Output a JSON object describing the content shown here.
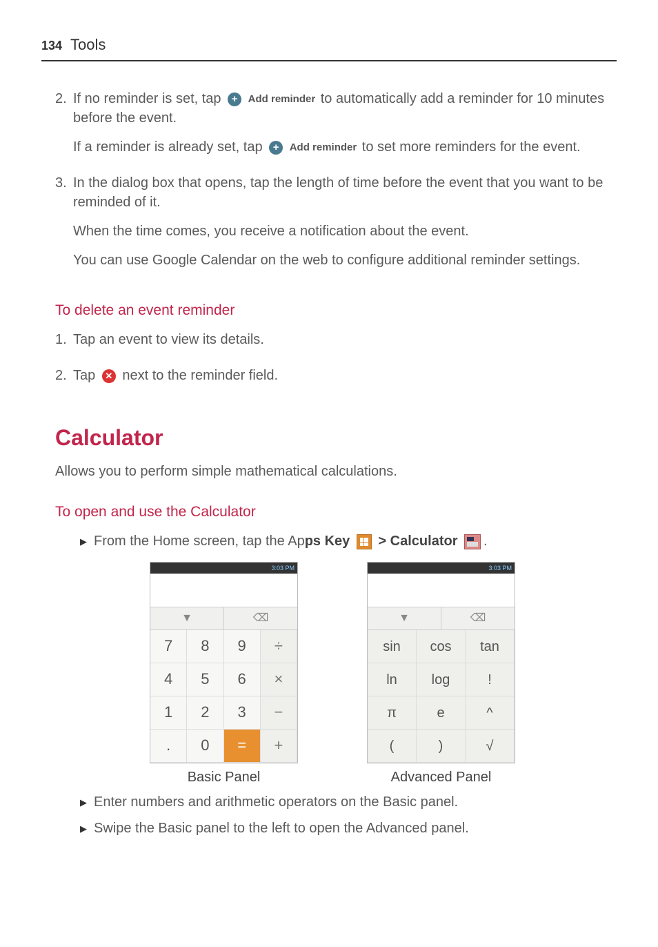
{
  "header": {
    "page": "134",
    "title": "Tools"
  },
  "steps": {
    "s2_num": "2.",
    "s2_a": "If no reminder is set, tap ",
    "s2_b": " to automatically add a reminder for 10 minutes before the event.",
    "s2_c": "If a reminder is already set, tap ",
    "s2_d": " to set more reminders for the event.",
    "add_reminder_label": "Add reminder",
    "s3_num": "3.",
    "s3_a": "In the dialog box that opens, tap the length of time before the event that you want to be reminded of it.",
    "s3_b": "When the time comes, you receive a notification about the event.",
    "s3_c": "You can use Google Calendar on the web to configure additional reminder settings."
  },
  "delete_section": {
    "heading": "To delete an event reminder",
    "d1_num": "1.",
    "d1": "Tap an event to view its details.",
    "d2_num": "2.",
    "d2_a": "Tap ",
    "d2_b": " next to the reminder field."
  },
  "calculator": {
    "heading": "Calculator",
    "intro": "Allows you to perform simple mathematical calculations.",
    "sub": "To open and use the Calculator",
    "line1_a": "From the Home screen, tap the Ap",
    "line1_b": "ps Key ",
    "line1_c": " > ",
    "line1_d": "Calculator ",
    "line1_e": ".",
    "bullet2": "Enter numbers and arithmetic operators on the Basic panel.",
    "bullet3": "Swipe the Basic panel to the left to open the Advanced panel."
  },
  "panels": {
    "basic_caption": "Basic Panel",
    "advanced_caption": "Advanced Panel",
    "status_time": "3:03 PM",
    "dropdown_glyph": "▼",
    "backspace_glyph": "⌫",
    "basic_keys": [
      {
        "label": "7",
        "cls": ""
      },
      {
        "label": "8",
        "cls": ""
      },
      {
        "label": "9",
        "cls": ""
      },
      {
        "label": "÷",
        "cls": "op"
      },
      {
        "label": "4",
        "cls": ""
      },
      {
        "label": "5",
        "cls": ""
      },
      {
        "label": "6",
        "cls": ""
      },
      {
        "label": "×",
        "cls": "op"
      },
      {
        "label": "1",
        "cls": ""
      },
      {
        "label": "2",
        "cls": ""
      },
      {
        "label": "3",
        "cls": ""
      },
      {
        "label": "−",
        "cls": "op"
      },
      {
        "label": ".",
        "cls": ""
      },
      {
        "label": "0",
        "cls": ""
      },
      {
        "label": "=",
        "cls": "eq"
      },
      {
        "label": "+",
        "cls": "op"
      }
    ],
    "adv_keys": [
      {
        "label": "sin",
        "cls": "adv-k"
      },
      {
        "label": "cos",
        "cls": "adv-k"
      },
      {
        "label": "tan",
        "cls": "adv-k"
      },
      {
        "label": "ln",
        "cls": "adv-k"
      },
      {
        "label": "log",
        "cls": "adv-k"
      },
      {
        "label": "!",
        "cls": "adv-k"
      },
      {
        "label": "π",
        "cls": "adv-k"
      },
      {
        "label": "e",
        "cls": "adv-k"
      },
      {
        "label": "^",
        "cls": "adv-k"
      },
      {
        "label": "(",
        "cls": "adv-k"
      },
      {
        "label": ")",
        "cls": "adv-k"
      },
      {
        "label": "√",
        "cls": "adv-k"
      }
    ]
  }
}
